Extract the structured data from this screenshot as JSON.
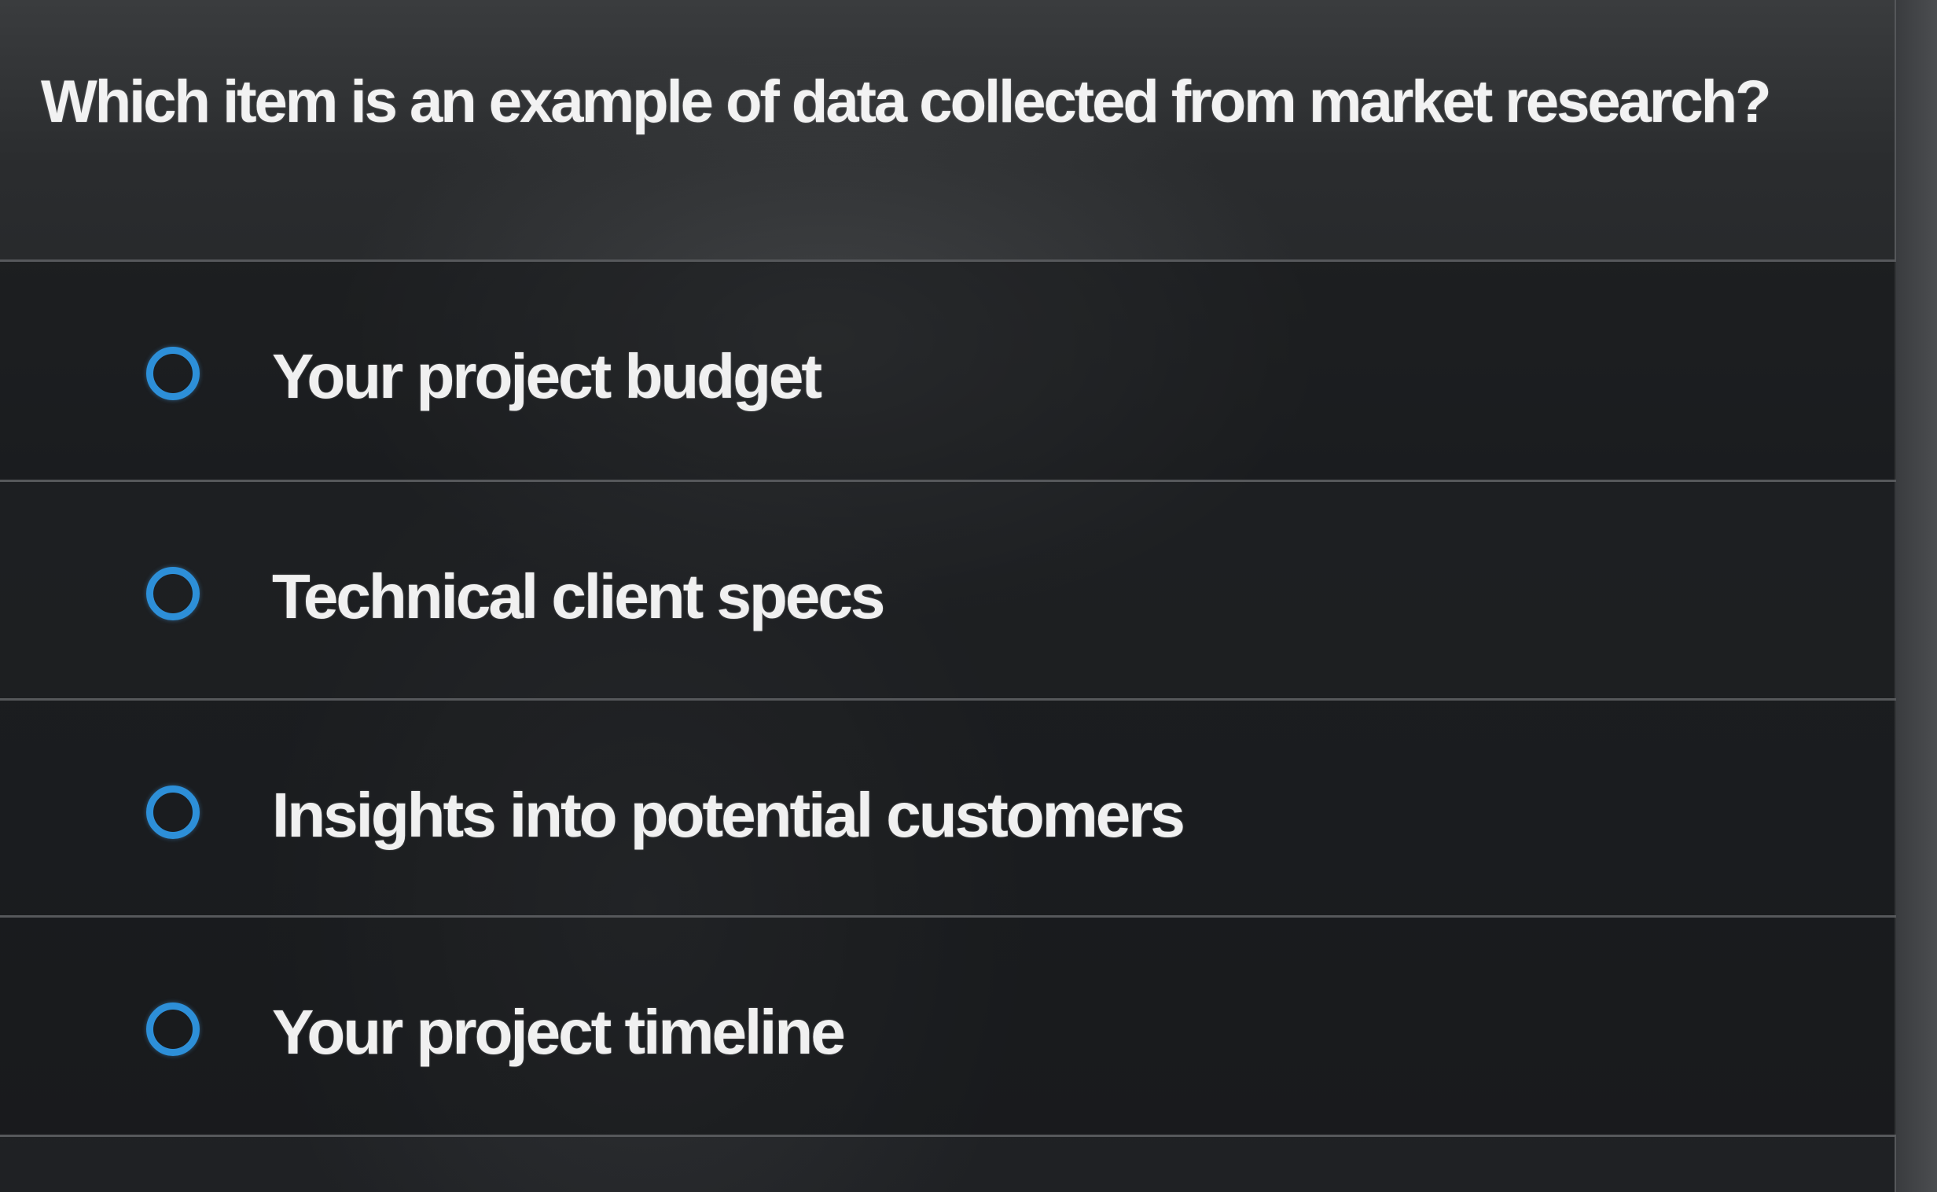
{
  "question": {
    "text": "Which item is an example of data collected from market research?"
  },
  "options": [
    {
      "label": "Your project budget",
      "selected": false
    },
    {
      "label": "Technical client specs",
      "selected": false
    },
    {
      "label": "Insights into potential customers",
      "selected": false
    },
    {
      "label": "Your project timeline",
      "selected": false
    }
  ],
  "colors": {
    "background": "#1f2124",
    "text": "#f0f0f0",
    "radio_accent": "#2d8fd8",
    "divider": "#56585b"
  }
}
